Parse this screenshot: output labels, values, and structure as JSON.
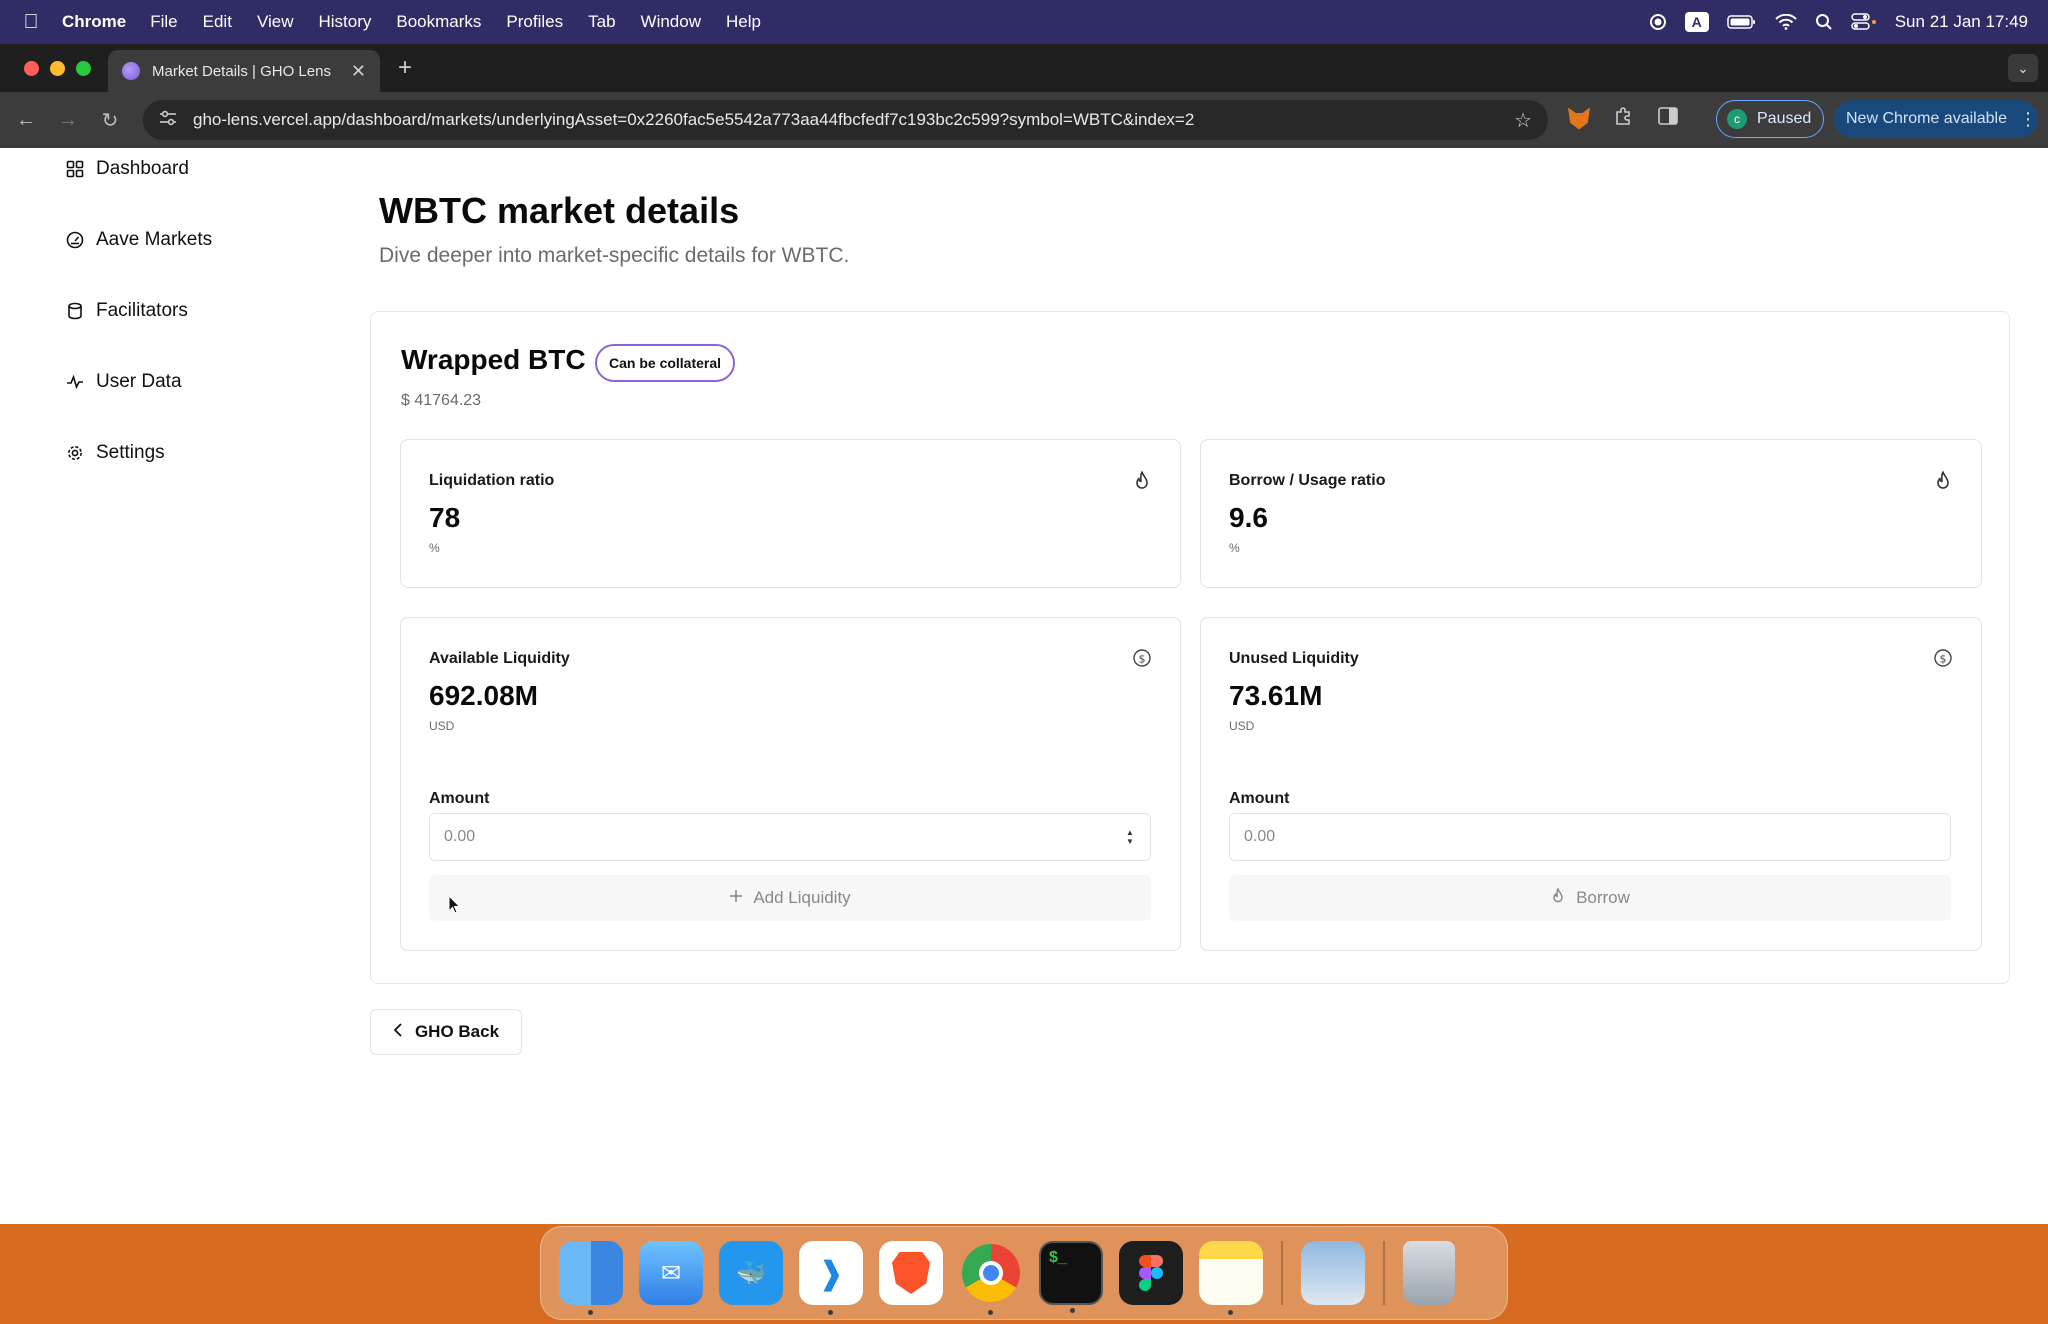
{
  "menubar": {
    "app_name": "Chrome",
    "items": [
      "File",
      "Edit",
      "View",
      "History",
      "Bookmarks",
      "Profiles",
      "Tab",
      "Window",
      "Help"
    ],
    "input_badge": "A",
    "datetime": "Sun 21 Jan  17:49"
  },
  "browser": {
    "tab_title": "Market Details | GHO Lens",
    "url": "gho-lens.vercel.app/dashboard/markets/underlyingAsset=0x2260fac5e5542a773aa44fbcfedf7c193bc2c599?symbol=WBTC&index=2",
    "profile_initial": "c",
    "profile_status": "Paused",
    "update_label": "New Chrome available"
  },
  "sidebar": {
    "items": [
      {
        "label": "Dashboard",
        "icon": "grid-icon"
      },
      {
        "label": "Aave Markets",
        "icon": "gauge-icon"
      },
      {
        "label": "Facilitators",
        "icon": "cylinder-icon"
      },
      {
        "label": "User Data",
        "icon": "activity-icon"
      },
      {
        "label": "Settings",
        "icon": "gear-icon"
      }
    ]
  },
  "page": {
    "title": "WBTC market details",
    "subtitle": "Dive deeper into market-specific details for WBTC."
  },
  "market": {
    "asset_name": "Wrapped BTC",
    "badge": "Can be collateral",
    "price": "$ 41764.23",
    "stats": [
      {
        "label": "Liquidation ratio",
        "value": "78",
        "unit": "%",
        "icon": "flame-icon"
      },
      {
        "label": "Borrow / Usage ratio",
        "value": "9.6",
        "unit": "%",
        "icon": "flame-icon"
      },
      {
        "label": "Available Liquidity",
        "value": "692.08M",
        "unit": "USD",
        "icon": "dollar-circle-icon"
      },
      {
        "label": "Unused Liquidity",
        "value": "73.61M",
        "unit": "USD",
        "icon": "dollar-circle-icon"
      }
    ],
    "add_form": {
      "amount_label": "Amount",
      "placeholder": "0.00",
      "button_label": "Add Liquidity"
    },
    "borrow_form": {
      "amount_label": "Amount",
      "placeholder": "0.00",
      "button_label": "Borrow"
    }
  },
  "back_button": "GHO Back",
  "dock": {
    "apps": [
      "finder",
      "mail",
      "docker",
      "vscode",
      "brave",
      "chrome",
      "terminal",
      "figma",
      "notes",
      "preview",
      "trash"
    ]
  }
}
